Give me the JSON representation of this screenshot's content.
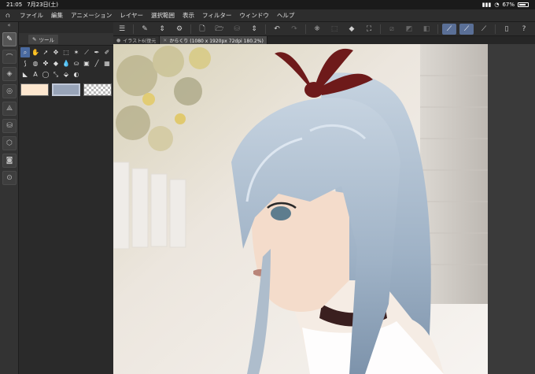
{
  "status": {
    "time": "21:05",
    "date": "7月23日(土)",
    "battery": "67%"
  },
  "menu": [
    "ファイル",
    "編集",
    "アニメーション",
    "レイヤー",
    "選択範囲",
    "表示",
    "フィルター",
    "ウィンドウ",
    "ヘルプ"
  ],
  "tool_panel": {
    "tab_label": "ツール"
  },
  "doc_tabs": [
    {
      "label": "イラスト6(復元"
    },
    {
      "label": "からくり (1080 x 1920px 72dpi 180.2%)"
    }
  ],
  "icons": {
    "app_logo": "clip-studio-logo-icon",
    "left_tools": [
      "pen-icon",
      "brush-icon",
      "layer-icon",
      "navigator-icon",
      "sub-tool-icon",
      "color-icon",
      "material-icon",
      "camera-icon",
      "search-icon"
    ]
  },
  "colors": {
    "main": "#fde7cf",
    "sub": "#98a4b8"
  }
}
